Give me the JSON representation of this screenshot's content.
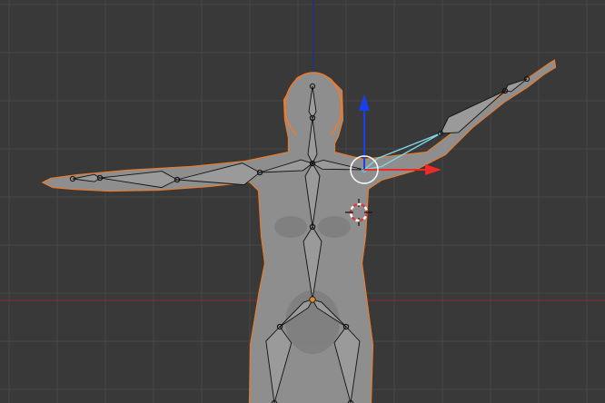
{
  "viewport": {
    "mode": "pose",
    "view": "front",
    "background_color": "#393939",
    "grid_color": "#474747",
    "axis_x_color": "#8a2c34",
    "axis_z_color": "#1b2d9a"
  },
  "mesh": {
    "name": "human-figure",
    "fill_color": "#8e8e8e",
    "selection_outline_color": "#f07a2a",
    "selected": true
  },
  "armature": {
    "bone_fill_color": "#9a9a9a",
    "bone_outline_color": "#111111",
    "active_bone_color": "#7fd7e6",
    "active_bone": "upper-arm-left",
    "root_joint_color": "#e08a2a"
  },
  "manipulator": {
    "type": "translate",
    "x_axis_color": "#ee2a2a",
    "z_axis_color": "#1a3ff0",
    "center_ring_color": "#ffffff"
  },
  "cursor_3d": {
    "ring_colors": [
      "#d83a3a",
      "#ffffff"
    ],
    "crosshair_color": "#111111"
  }
}
